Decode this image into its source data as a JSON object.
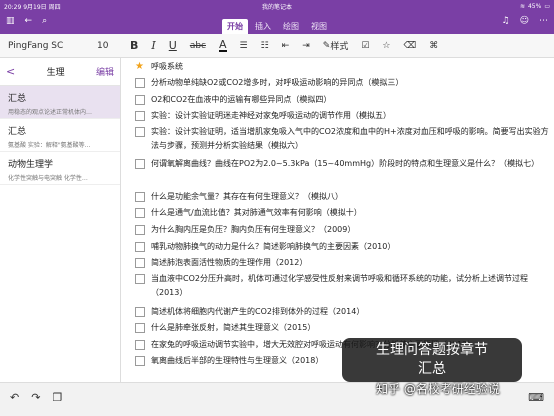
{
  "status": {
    "time": "20:29",
    "date": "9月19日 周四",
    "battery": "45%",
    "notebook_title": "我的笔记本"
  },
  "tabs": [
    "开始",
    "插入",
    "绘图",
    "视图"
  ],
  "toolbar": {
    "font": "PingFang SC",
    "size": "10",
    "bold": "B",
    "italic": "I",
    "underline": "U",
    "strike": "abc",
    "color": "A",
    "style": "样式"
  },
  "sidebar": {
    "back": "<",
    "title": "生理",
    "edit": "编辑",
    "pages": [
      {
        "title": "汇总",
        "subtitle": "用稳态的观点论述正常机体内…",
        "selected": true
      },
      {
        "title": "汇总",
        "subtitle": "氨基酸 实验：解释\"氨基酸等…",
        "selected": false
      },
      {
        "title": "动物生理学",
        "subtitle": "化学性突触与电突触 化学性…",
        "selected": false
      }
    ]
  },
  "note": {
    "heading": "呼吸系统",
    "items": [
      "分析动物单纯缺O2或CO2增多时，对呼吸运动影响的异同点（模拟三）",
      "O2和CO2在血液中的运输有哪些异同点（模拟四）",
      "实验：设计实验证明迷走神经对家兔呼吸运动的调节作用（模拟五）",
      "实验：设计实验证明，适当增肌家兔吸入气中的CO2浓度和血中的H+浓度对血压和呼吸的影响。简要写出实验方法与步骤，预测并分析实验结果（模拟六）",
      "何谓氧解离曲线？曲线在PO2为2.0~5.3kPa（15~40mmHg）阶段时的特点和生理意义是什么？（模拟七）",
      "什么是功能余气量？其存在有何生理意义？（模拟八）",
      "什么是通气/血流比值？其对肺通气效率有何影响（模拟十）",
      "为什么胸内压是负压？胸内负压有何生理意义？（2009）",
      "哺乳动物肺换气的动力是什么？简述影响肺换气的主要因素（2010）",
      "简述肺泡表面活性物质的生理作用（2012）",
      "当血液中CO2分压升高时，机体可通过化学感受性反射来调节呼吸和循环系统的功能，试分析上述调节过程（2013）",
      "简述机体将细胞内代谢产生的CO2排到体外的过程（2014）",
      "什么是肺牵张反射，简述其生理意义（2015）",
      "在家兔的呼吸运动调节实验中，增大无效腔对呼吸运动有何影响？分析其主要原理（2017）",
      "氧离曲线后半部的生理特性与生理意义（2018）"
    ]
  },
  "overlay": {
    "line1": "生理问答题按章节",
    "line2": "汇总",
    "watermark": "知乎 @名校考研经验说"
  }
}
